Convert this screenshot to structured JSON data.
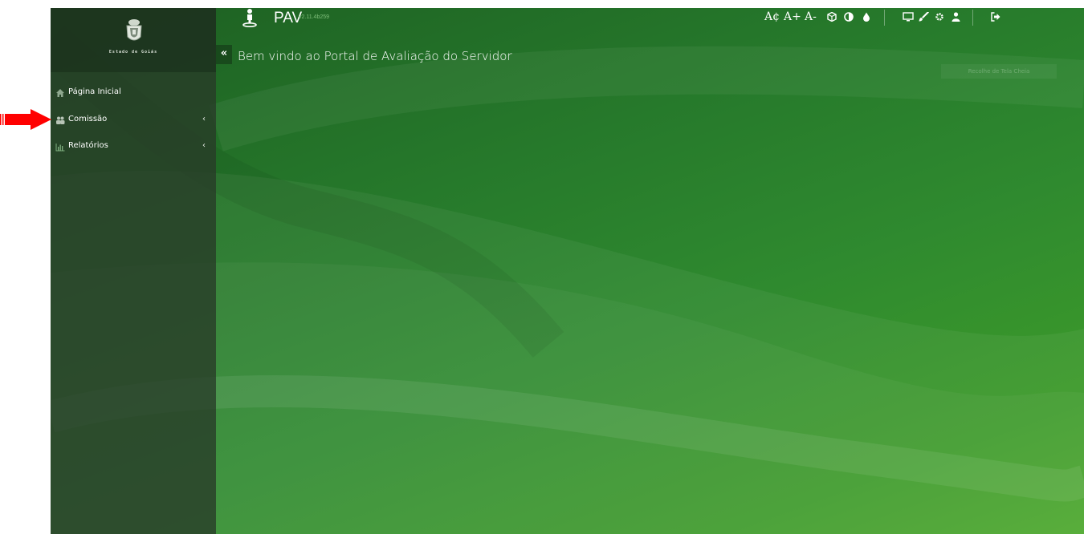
{
  "header": {
    "app_title": "PAV",
    "version": "v2.11.4b259",
    "welcome": "Bem vindo ao Portal de Avaliação do Servidor",
    "tooltip_text": "Recolhe de Tela Cheia"
  },
  "logo": {
    "caption": "Estado de Goiás"
  },
  "sidebar": {
    "items": [
      {
        "label": "Página Inicial",
        "icon": "home-icon",
        "has_submenu": false
      },
      {
        "label": "Comissão",
        "icon": "users-icon",
        "has_submenu": true,
        "chevron": "‹"
      },
      {
        "label": "Relatórios",
        "icon": "bar-chart-icon",
        "has_submenu": true,
        "chevron": "‹"
      }
    ]
  },
  "toolbar": {
    "font_reset": "A¢",
    "font_increase": "A+",
    "font_decrease": "A-",
    "icons": [
      "cube-icon",
      "contrast-icon",
      "tint-icon",
      "monitor-icon",
      "brush-icon",
      "gear-icon",
      "user-icon",
      "logout-icon"
    ]
  },
  "colors": {
    "accent_green": "#2f8a2f",
    "sidebar_bg": "#283a28",
    "annotation_arrow": "#ff0000"
  }
}
